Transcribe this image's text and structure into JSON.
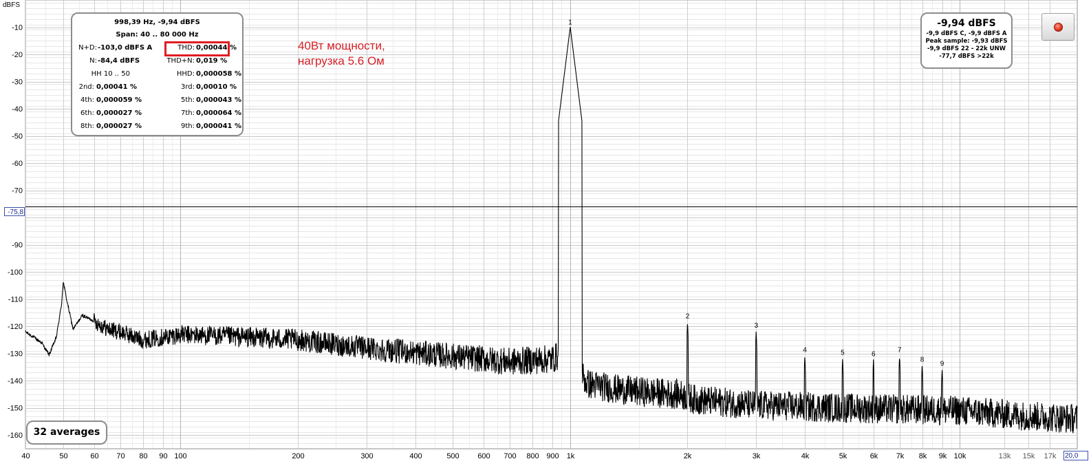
{
  "chart_data": {
    "type": "line",
    "title": "",
    "ylabel": "dBFS",
    "xlabel": "",
    "xscale": "log",
    "xlim": [
      40,
      20000
    ],
    "ylim": [
      -165,
      0
    ],
    "grid": true,
    "y_ticks": [
      {
        "value": -10,
        "label": "-10"
      },
      {
        "value": -20,
        "label": "-20"
      },
      {
        "value": -30,
        "label": "-30"
      },
      {
        "value": -40,
        "label": "-40"
      },
      {
        "value": -50,
        "label": "-50"
      },
      {
        "value": -60,
        "label": "-60"
      },
      {
        "value": -70,
        "label": "-70"
      },
      {
        "value": -90,
        "label": "-90"
      },
      {
        "value": -100,
        "label": "-100"
      },
      {
        "value": -110,
        "label": "-110"
      },
      {
        "value": -120,
        "label": "-120"
      },
      {
        "value": -130,
        "label": "-130"
      },
      {
        "value": -140,
        "label": "-140"
      },
      {
        "value": -150,
        "label": "-150"
      },
      {
        "value": -160,
        "label": "-160"
      }
    ],
    "x_ticks": [
      {
        "value": 40,
        "label": "40"
      },
      {
        "value": 50,
        "label": "50"
      },
      {
        "value": 60,
        "label": "60"
      },
      {
        "value": 70,
        "label": "70"
      },
      {
        "value": 80,
        "label": "80"
      },
      {
        "value": 90,
        "label": "90"
      },
      {
        "value": 100,
        "label": "100"
      },
      {
        "value": 200,
        "label": "200"
      },
      {
        "value": 300,
        "label": "300"
      },
      {
        "value": 400,
        "label": "400"
      },
      {
        "value": 500,
        "label": "500"
      },
      {
        "value": 600,
        "label": "600"
      },
      {
        "value": 700,
        "label": "700"
      },
      {
        "value": 800,
        "label": "800"
      },
      {
        "value": 900,
        "label": "900"
      },
      {
        "value": 1000,
        "label": "1k"
      },
      {
        "value": 2000,
        "label": "2k"
      },
      {
        "value": 3000,
        "label": "3k"
      },
      {
        "value": 4000,
        "label": "4k"
      },
      {
        "value": 5000,
        "label": "5k"
      },
      {
        "value": 6000,
        "label": "6k"
      },
      {
        "value": 7000,
        "label": "7k"
      },
      {
        "value": 8000,
        "label": "8k"
      },
      {
        "value": 9000,
        "label": "9k"
      },
      {
        "value": 10000,
        "label": "10k"
      },
      {
        "value": 13000,
        "label": "13k"
      },
      {
        "value": 15000,
        "label": "15k"
      },
      {
        "value": 17000,
        "label": "17k"
      }
    ],
    "cursor": {
      "value": -75.8,
      "label": "-75,8"
    },
    "x_end_label": "20,0",
    "harmonics": [
      {
        "label": "1",
        "freq": 1000,
        "level": -9.94
      },
      {
        "label": "2",
        "freq": 2000,
        "level": -118
      },
      {
        "label": "3",
        "freq": 3000,
        "level": -121.5
      },
      {
        "label": "4",
        "freq": 4000,
        "level": -130.5
      },
      {
        "label": "5",
        "freq": 5000,
        "level": -131.5
      },
      {
        "label": "6",
        "freq": 6000,
        "level": -132
      },
      {
        "label": "7",
        "freq": 7000,
        "level": -130.5
      },
      {
        "label": "8",
        "freq": 8000,
        "level": -134
      },
      {
        "label": "9",
        "freq": 9000,
        "level": -135.5
      }
    ],
    "noise_floor": [
      [
        40,
        -122
      ],
      [
        42,
        -124
      ],
      [
        44,
        -126
      ],
      [
        46,
        -130.5
      ],
      [
        48,
        -124
      ],
      [
        49.5,
        -112
      ],
      [
        50,
        -103.5
      ],
      [
        51,
        -110
      ],
      [
        53,
        -121
      ],
      [
        56,
        -116
      ],
      [
        60,
        -118
      ],
      [
        65,
        -121
      ],
      [
        70,
        -122
      ],
      [
        80,
        -125
      ],
      [
        90,
        -124
      ],
      [
        100,
        -123
      ],
      [
        150,
        -124
      ],
      [
        200,
        -125
      ],
      [
        300,
        -128
      ],
      [
        500,
        -131
      ],
      [
        700,
        -133
      ],
      [
        900,
        -132
      ],
      [
        960,
        -130
      ],
      [
        1040,
        -133
      ],
      [
        1100,
        -141
      ],
      [
        1300,
        -143
      ],
      [
        1500,
        -144
      ],
      [
        1900,
        -145
      ],
      [
        2100,
        -147
      ],
      [
        3000,
        -149
      ],
      [
        5000,
        -150
      ],
      [
        10000,
        -151
      ],
      [
        15000,
        -153
      ],
      [
        20000,
        -154
      ]
    ],
    "series": [
      {
        "values_note_ref": "noise_floor"
      }
    ],
    "line_color": "#000000",
    "grid_color": "#cdcdcd",
    "cursor_color": "#000000"
  },
  "stats_panel": {
    "freq_level": "998,39 Hz, -9,94 dBFS",
    "span": "Span: 40 .. 80 000 Hz",
    "nd_label": "N+D:",
    "nd_value": "-103,0 dBFS A",
    "thd_label": "THD:",
    "thd_value": "0,00044 %",
    "n_label": "N:",
    "n_value": "-84,4 dBFS",
    "thdn_label": "THD+N:",
    "thdn_value": "0,019 %",
    "hh_label": "HH 10 .. 50",
    "hhd_label": "HHD:",
    "hhd_value": "0,000058 %",
    "h2_label": "2nd:",
    "h2_value": "0,00041 %",
    "h3_label": "3rd:",
    "h3_value": "0,00010 %",
    "h4_label": "4th:",
    "h4_value": "0,000059 %",
    "h5_label": "5th:",
    "h5_value": "0,000043 %",
    "h6_label": "6th:",
    "h6_value": "0,000027 %",
    "h7_label": "7th:",
    "h7_value": "0,000064 %",
    "h8_label": "8th:",
    "h8_value": "0,000027 %",
    "h9_label": "9th:",
    "h9_value": "0,000041 %",
    "highlight_color": "#e01c24"
  },
  "level_panel": {
    "main": "-9,94 dBFS",
    "line1": "-9,9 dBFS C, -9,9 dBFS A",
    "line2": "Peak sample: -9,93 dBFS",
    "line3": "-9,9 dBFS 22 - 22k UNW",
    "line4": "-77,7 dBFS >22k"
  },
  "annotation": {
    "line1": "40Вт мощности,",
    "line2": "нагрузка 5.6 Ом",
    "color": "#d62027"
  },
  "averages_panel": {
    "label": "32 averages"
  },
  "record_button": {
    "icon": "record-icon",
    "color": "#e23a1f"
  }
}
